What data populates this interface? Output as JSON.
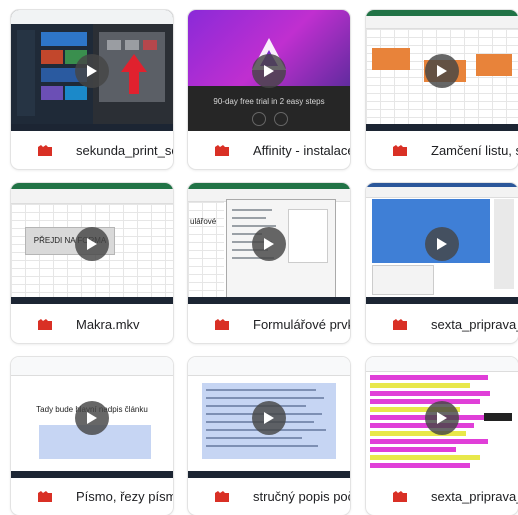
{
  "files": [
    {
      "name": "sekunda_print_scre..."
    },
    {
      "name": "Affinity - instalace..."
    },
    {
      "name": "Zamčení listu, sešit..."
    },
    {
      "name": "Makra.mkv"
    },
    {
      "name": "Formulářové prvky..."
    },
    {
      "name": "sexta_priprava_rp.m..."
    },
    {
      "name": "Písmo, řezy písma, f..."
    },
    {
      "name": "stručný popis počíta..."
    },
    {
      "name": "sexta_priprava_RP_..."
    }
  ],
  "thumbs": {
    "affinity_caption": "90-day free trial in 2 easy steps",
    "makra_button": "PŘEJDI NA FORMA",
    "formular_label": "ulářové",
    "pismo_heading": "Tady bude hlavní nadpis článku"
  },
  "icons": {
    "play": "play-icon",
    "file": "video-file-icon"
  },
  "colors": {
    "video_icon": "#d93025",
    "play_bg": "#464646",
    "excel_green": "#217346"
  }
}
